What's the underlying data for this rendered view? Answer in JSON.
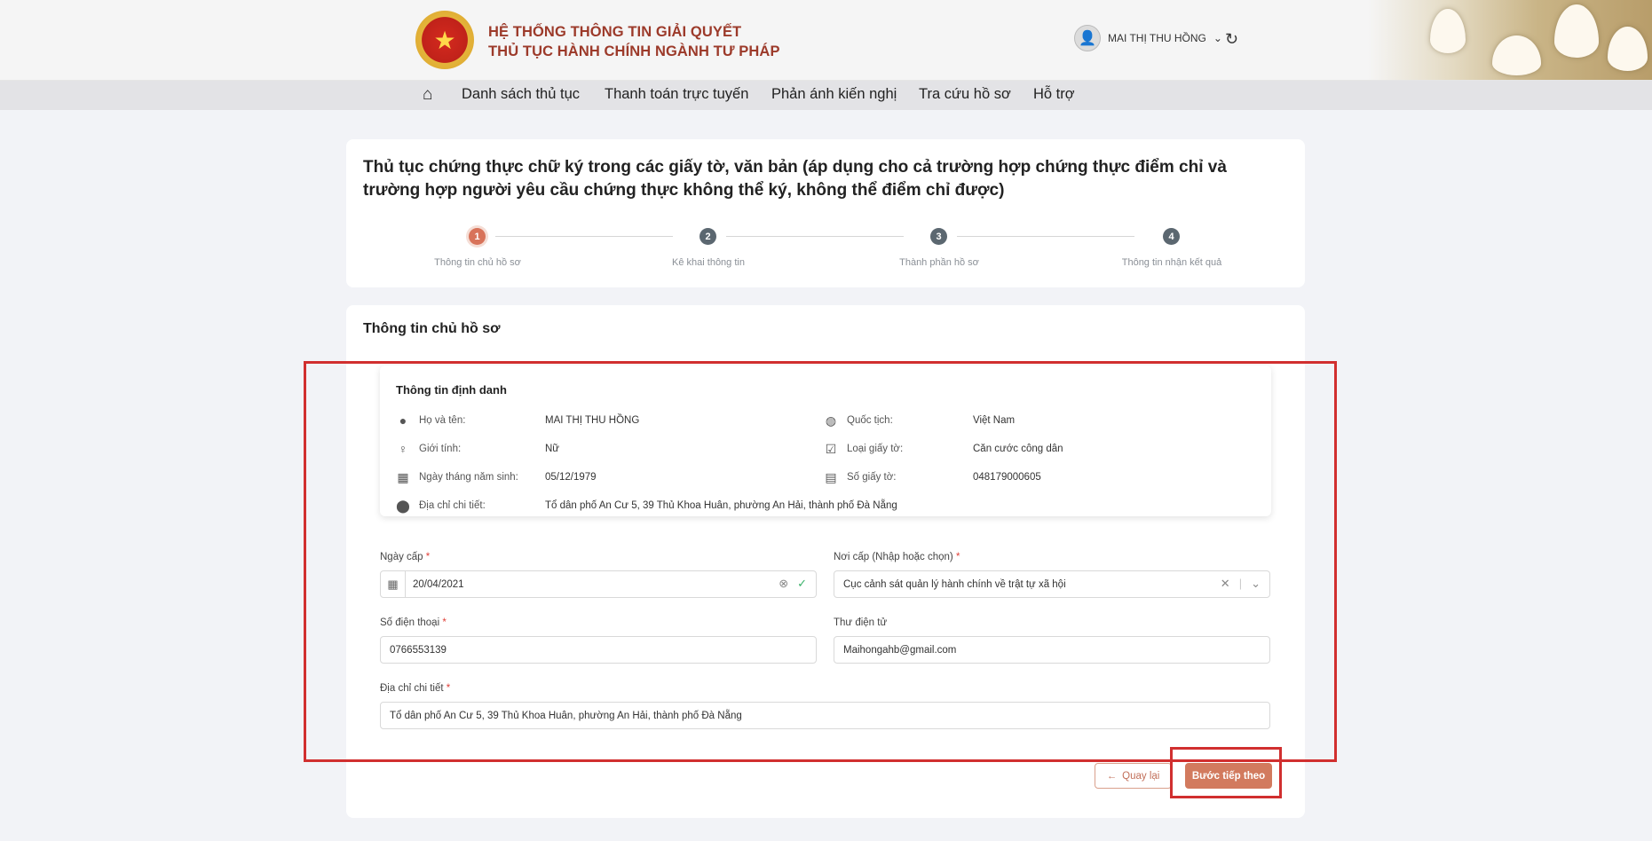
{
  "header": {
    "title_line1": "HỆ THỐNG THÔNG TIN GIẢI QUYẾT",
    "title_line2": "THỦ TỤC HÀNH CHÍNH NGÀNH TƯ PHÁP",
    "user_name": "MAI THỊ THU HỒNG"
  },
  "nav": {
    "items": [
      "Danh sách thủ tục",
      "Thanh toán trực tuyến",
      "Phản ánh kiến nghị",
      "Tra cứu hồ sơ",
      "Hỗ trợ"
    ]
  },
  "procedure": {
    "title": "Thủ tục chứng thực chữ ký trong các giấy tờ, văn bản (áp dụng cho cả trường hợp chứng thực điểm chỉ và trường hợp người yêu cầu chứng thực không thể ký, không thể điểm chỉ được)",
    "steps": [
      {
        "num": "1",
        "label": "Thông tin chủ hồ sơ"
      },
      {
        "num": "2",
        "label": "Kê khai thông tin"
      },
      {
        "num": "3",
        "label": "Thành phần hồ sơ"
      },
      {
        "num": "4",
        "label": "Thông tin nhận kết quả"
      }
    ]
  },
  "owner": {
    "section_title": "Thông tin chủ hồ sơ",
    "identity_title": "Thông tin định danh",
    "fields": {
      "name_label": "Họ và tên:",
      "name_value": "MAI THỊ THU HỒNG",
      "nationality_label": "Quốc tịch:",
      "nationality_value": "Việt Nam",
      "gender_label": "Giới tính:",
      "gender_value": "Nữ",
      "doctype_label": "Loại giấy tờ:",
      "doctype_value": "Căn cước công dân",
      "dob_label": "Ngày tháng năm sinh:",
      "dob_value": "05/12/1979",
      "docnum_label": "Số giấy tờ:",
      "docnum_value": "048179000605",
      "address_label": "Địa chỉ chi tiết:",
      "address_value": "Tổ dân phố An Cư 5, 39 Thủ Khoa Huân, phường An Hải, thành phố Đà Nẵng"
    }
  },
  "form": {
    "issue_date_label": "Ngày cấp",
    "issue_date_value": "20/04/2021",
    "issue_place_label": "Nơi cấp (Nhập hoặc chọn)",
    "issue_place_value": "Cục cảnh sát quản lý hành chính về trật tự xã hội",
    "phone_label": "Số điện thoại",
    "phone_value": "0766553139",
    "email_label": "Thư điện tử",
    "email_value": "Maihongahb@gmail.com",
    "address_label": "Địa chỉ chi tiết",
    "address_value": "Tổ dân phố An Cư 5, 39 Thủ Khoa Huân, phường An Hải, thành phố Đà Nẵng",
    "required_mark": "*"
  },
  "buttons": {
    "back": "Quay lại",
    "next": "Bước tiếp theo"
  },
  "colors": {
    "accent": "#d27a5e",
    "title_red": "#9c3a2a",
    "highlight": "#d12f2f"
  }
}
